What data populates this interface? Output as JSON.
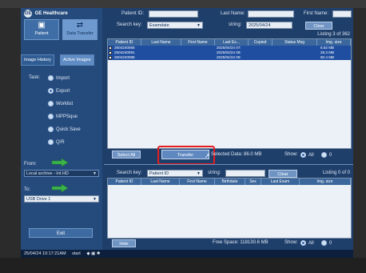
{
  "brand": {
    "mark": "GE",
    "name": "GE Healthcare"
  },
  "left_panel": {
    "tabs": [
      {
        "label": "Patient",
        "icon": "patient-icon"
      },
      {
        "label": "Data Transfer",
        "icon": "data-transfer-icon"
      },
      {
        "label": "Image History",
        "icon": "image-history-icon"
      },
      {
        "label": "Active Images",
        "icon": "active-images-icon"
      }
    ],
    "task_label": "Task:",
    "tasks": [
      "Import",
      "Export",
      "Worklist",
      "MPPSque",
      "Quick Save",
      "Q/R"
    ],
    "selected_task": "Export",
    "from_label": "From:",
    "from_value": "Local archive - Int HD",
    "to_label": "To:",
    "to_value": "USB Drive 1",
    "exit_label": "Exit"
  },
  "top_panel": {
    "patient_id_label": "Patient ID:",
    "patient_id_value": "",
    "last_name_label": "Last Name:",
    "last_name_value": "",
    "first_name_label": "First Name:",
    "first_name_value": "",
    "search_key_label": "Search key:",
    "search_key_value": "Examdate",
    "string_label": "string:",
    "string_value": "2025/04/24",
    "clear_label": "Clear",
    "listing": "Listing 3 of 362",
    "columns": [
      "Patient ID",
      "Last Name",
      "First Name",
      "Last Ex...",
      "Copied",
      "Status Msg",
      "Img. size"
    ],
    "rows": [
      {
        "patient_id": "2504240066",
        "last_exam": "2025/04/24 07:",
        "img_size": "6.52 MB"
      },
      {
        "patient_id": "2504240091",
        "last_exam": "2025/04/24 08:",
        "img_size": "28.3 MB"
      },
      {
        "patient_id": "2504240088",
        "last_exam": "2025/04/24 09:",
        "img_size": "50.4 MB"
      }
    ],
    "select_all_label": "Select All",
    "transfer_label": "Transfer",
    "selected_data": "Selected Data: 86.0 MB",
    "show_label": "Show:",
    "show_options": [
      "All",
      "0"
    ]
  },
  "bottom_panel": {
    "search_key_label": "Search key:",
    "search_key_value": "Patient ID",
    "string_label": "string:",
    "string_value": "",
    "clear_label": "Clear",
    "listing": "Listing 0 of 0",
    "columns": [
      "Patient ID",
      "Last Name",
      "First Name",
      "Birthdate",
      "Sex",
      "Last Exam",
      "Img. size"
    ],
    "hide_label": "Hide",
    "free_space": "Free Space: 118130.6 MB",
    "show_label": "Show:",
    "show_options": [
      "All",
      "0"
    ]
  },
  "status_bar": {
    "datetime": "25/04/24 10:17:21AM",
    "start_label": "start"
  },
  "colors": {
    "screen_bg": "#1f3f6b",
    "row_highlight": "#1f4ea0",
    "highlight_box": "#e41d1d"
  }
}
